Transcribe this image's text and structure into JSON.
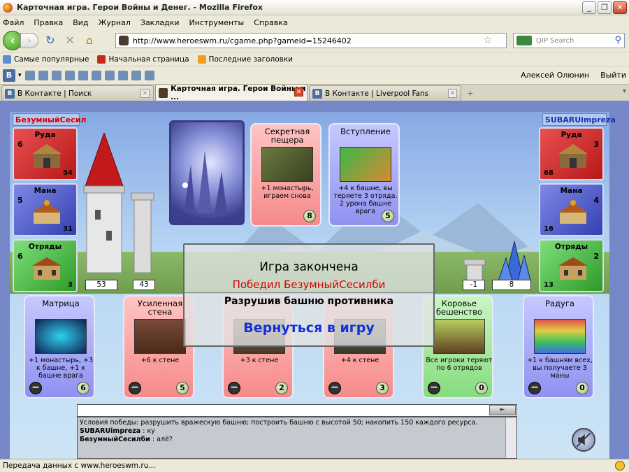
{
  "window": {
    "title": "Карточная игра. Герои Войны и Денег. - Mozilla Firefox"
  },
  "menu": [
    "Файл",
    "Правка",
    "Вид",
    "Журнал",
    "Закладки",
    "Инструменты",
    "Справка"
  ],
  "nav": {
    "url": "http://www.heroeswm.ru/cgame.php?gameid=15246402",
    "search_placeholder": "QIP Search"
  },
  "bookmarks": [
    "Самые популярные",
    "Начальная страница",
    "Последние заголовки"
  ],
  "vkbar": {
    "logo": "В",
    "user": "Алексей Олюнин",
    "logout": "Выйти"
  },
  "tabs": [
    {
      "label": "В Контакте | Поиск",
      "icon": "В"
    },
    {
      "label": "Карточная игра. Герои Войны и ...",
      "icon": ""
    },
    {
      "label": "В Контакте | Liverpool Fans",
      "icon": "В"
    }
  ],
  "game": {
    "player_left": {
      "name": "БезумныйСесил",
      "tower": "53",
      "wall": "43",
      "resources": [
        {
          "label": "Руда",
          "income": "6",
          "amount": "54"
        },
        {
          "label": "Мана",
          "income": "5",
          "amount": "31"
        },
        {
          "label": "Отряды",
          "income": "6",
          "amount": "3"
        }
      ]
    },
    "player_right": {
      "name": "SUBARUimpreza",
      "tower": "8",
      "wall": "-1",
      "resources": [
        {
          "label": "Руда",
          "income": "3",
          "amount": "68"
        },
        {
          "label": "Мана",
          "income": "4",
          "amount": "16"
        },
        {
          "label": "Отряды",
          "income": "2",
          "amount": "13"
        }
      ]
    },
    "played_cards": [
      {
        "name": "Секретная пещера",
        "desc": "+1 монастырь, играем снова",
        "cost": "8"
      },
      {
        "name": "Вступление",
        "desc": "+4 к башне, вы теряете 3 отряда. 2 урона башне врага",
        "cost": "5"
      }
    ],
    "hand": [
      {
        "name": "Матрица",
        "desc": "+1 монастырь, +3 к башне, +1 к башне врага",
        "cost": "6",
        "color": "blue"
      },
      {
        "name": "Усиленная стена",
        "desc": "+6 к стене",
        "cost": "5",
        "color": "red"
      },
      {
        "name": "",
        "desc": "+3 к стене",
        "cost": "2",
        "color": "red"
      },
      {
        "name": "",
        "desc": "+4 к стене",
        "cost": "3",
        "color": "red"
      },
      {
        "name": "Коровье бешенство",
        "desc": "Все игроки теряют по 6 отрядов",
        "cost": "0",
        "color": "green"
      },
      {
        "name": "Радуга",
        "desc": "+1 к башням всех, вы получаете 3 маны",
        "cost": "0",
        "color": "blue"
      }
    ],
    "discard_symbol": "−",
    "modal": {
      "title": "Игра закончена",
      "winner": "Победил БезумныйСесилби",
      "reason": "Разрушив башню противника",
      "return": "Вернуться в игру"
    },
    "chat": {
      "send": "►",
      "lines": [
        {
          "who": "",
          "text": "Условия победы: разрушить вражескую башню; построить башню с высотой 50; накопить 150 каждого ресурса."
        },
        {
          "who": "SUBARUimpreza",
          "text": " : ку"
        },
        {
          "who": "БезумныйСесилби",
          "text": " : алё?"
        }
      ]
    }
  },
  "status": "Передача данных с www.heroeswm.ru..."
}
